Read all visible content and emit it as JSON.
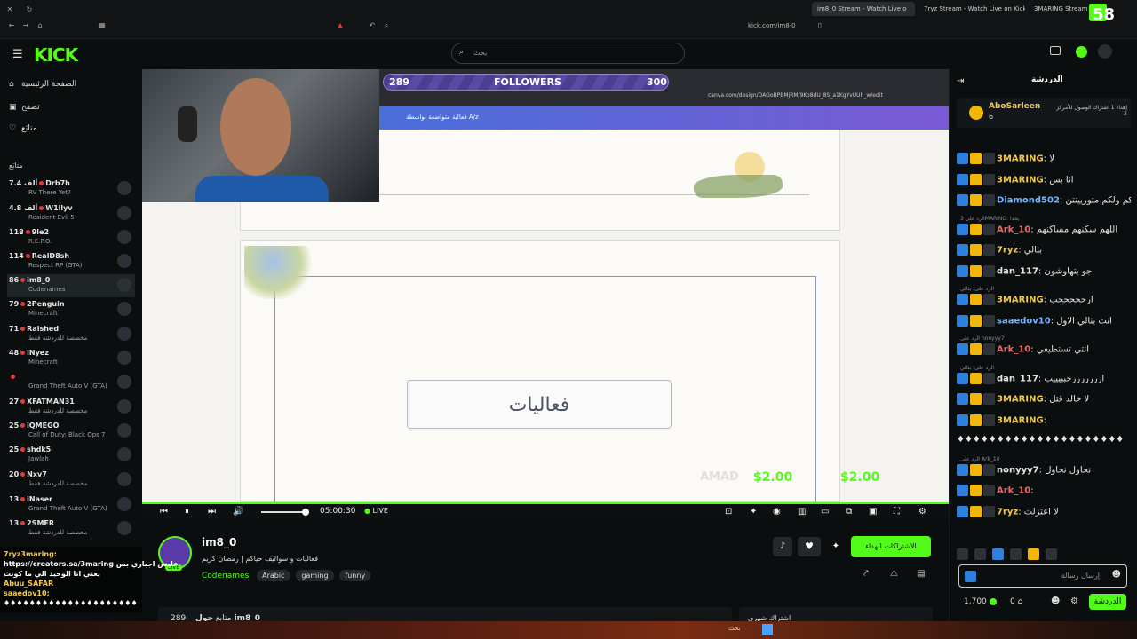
{
  "browser": {
    "tabs": [
      {
        "label": "im8_0 Stream - Watch Live o"
      },
      {
        "label": "7ryz Stream - Watch Live on Kick"
      },
      {
        "label": "3MARING Stream - Watc"
      }
    ],
    "url": "kick.com/im8-0",
    "viewer_overlay": "58"
  },
  "header": {
    "logo": "KICK",
    "search_placeholder": "بحث"
  },
  "sidebar": {
    "nav": [
      {
        "label": "الصفحة الرئيسية",
        "icon": "home-icon"
      },
      {
        "label": "تصفح",
        "icon": "browse-icon"
      },
      {
        "label": "متابَع",
        "icon": "heart-icon"
      }
    ],
    "section_title": "متابَع",
    "channels": [
      {
        "viewers": "7.4 ألف",
        "name": "Drb7h",
        "game": "RV There Yet?"
      },
      {
        "viewers": "4.8 ألف",
        "name": "W1llyv",
        "game": "Resident Evil 5"
      },
      {
        "viewers": "118",
        "name": "9le2",
        "game": "R.E.P.O."
      },
      {
        "viewers": "114",
        "name": "RealD8sh",
        "game": "Respect RP (GTA)"
      },
      {
        "viewers": "86",
        "name": "im8_0",
        "game": "Codenames"
      },
      {
        "viewers": "79",
        "name": "2Penguin",
        "game": "Minecraft"
      },
      {
        "viewers": "71",
        "name": "Raished",
        "game": "مخصصة للدردشة فقط"
      },
      {
        "viewers": "48",
        "name": "iNyez",
        "game": "Minecraft"
      },
      {
        "viewers": "",
        "name": "",
        "game": "Grand Theft Auto V (GTA)"
      },
      {
        "viewers": "27",
        "name": "XFATMAN31",
        "game": "مخصصة للدردشة فقط"
      },
      {
        "viewers": "25",
        "name": "iQMEGO",
        "game": "Call of Duty: Black Ops 7"
      },
      {
        "viewers": "25",
        "name": "shdk5",
        "game": "Jawlah"
      },
      {
        "viewers": "20",
        "name": "Nxv7",
        "game": "مخصصة للدردشة فقط"
      },
      {
        "viewers": "13",
        "name": "iNaser",
        "game": "Grand Theft Auto V (GTA)"
      },
      {
        "viewers": "13",
        "name": "2SMER",
        "game": "مخصصة للدردشة فقط"
      }
    ]
  },
  "overlay_chat": [
    "7ryz3maring:",
    "https://creators.sa/3maring عليش اجباري بس",
    "يعني انا الوحيد الي ما كونت",
    "Abuu_SAFAR",
    "saaedov10:",
    "♦♦♦♦♦♦♦♦♦♦♦♦♦♦♦♦♦♦♦♦♦"
  ],
  "video": {
    "followers_label": "FOLLOWERS",
    "followers_current": "289",
    "followers_goal": "300",
    "followers_progress": 0.96,
    "canva_url": "canva.com/design/DAGoBPBMjRM/9Ko8dU_8S_a1KgYvUUh_w/edit",
    "canva_title": "فعالية متواضعة بواسطة A/z",
    "card_text": "فعاليات",
    "prices": [
      "$2.00",
      "$2.00"
    ],
    "time": "05:00:30",
    "live_label": "LIVE"
  },
  "stream": {
    "channel": "im8_0",
    "title": "فعاليات و سواليف حياكم | رمضان كريم",
    "category": "Codenames",
    "tags": [
      "Arabic",
      "gaming",
      "funny"
    ],
    "subscribe_label": "الاشتراكات الهداء",
    "about_label": "حول im8_0",
    "followers_label": "289 متابع",
    "below_label": "اشتراك شهري"
  },
  "chat": {
    "title": "الدردشة",
    "pinned_user": "AboSarleen",
    "pinned_count": "6",
    "pinned_text": "إهداء 1 اشتراك الوصول للأمركز 2",
    "messages": [
      {
        "user": "3MARING",
        "text": "لا",
        "color": "#f2c94c"
      },
      {
        "user": "3MARING",
        "text": "انا بس",
        "color": "#f2c94c"
      },
      {
        "user": "Diamond502",
        "text": "ولكم ولكم متوريينتن",
        "color": "#6fb5ff"
      },
      {
        "user": "Ark_10",
        "text": "اللهم سكنهم مساكنهم",
        "color": "#e46b6b",
        "reply": "الرد على 3MARING: يحدا"
      },
      {
        "user": "7ryz",
        "text": "بثالي",
        "color": "#f2c94c"
      },
      {
        "user": "dan_117",
        "text": "جو يتهاوشون",
        "color": "#e5e5e5"
      },
      {
        "user": "3MARING",
        "text": "ارحححححب",
        "color": "#f2c94c",
        "reply": "الرد على: بثالي"
      },
      {
        "user": "saaedov10",
        "text": "انت بثالي الاول",
        "color": "#6fb5ff"
      },
      {
        "user": "Ark_10",
        "text": "انتي تستطيعي",
        "color": "#e46b6b",
        "reply": "الرد على nonyyy7"
      },
      {
        "user": "dan_117",
        "text": "ارررررررحببيييب",
        "color": "#e5e5e5",
        "reply": "الرد على: بثالي"
      },
      {
        "user": "3MARING",
        "text": "لا خالد قتل",
        "color": "#f2c94c"
      },
      {
        "user": "3MARING",
        "text": "",
        "color": "#f2c94c"
      },
      {
        "user": "",
        "text": "♦♦♦♦♦♦♦♦♦♦♦♦♦♦♦♦♦♦♦♦♦",
        "color": "#e5e5e5"
      },
      {
        "user": "nonyyy7",
        "text": "نحاول نحاول",
        "color": "#e5e5e5",
        "reply": "الرد على Ark_10"
      },
      {
        "user": "Ark_10",
        "text": "",
        "color": "#e46b6b"
      },
      {
        "user": "7ryz",
        "text": "لا اعتزلت",
        "color": "#f2c94c"
      }
    ],
    "input_placeholder": "إرسال رسالة",
    "points": "1,700",
    "count": "0",
    "send_label": "الدردشة"
  }
}
